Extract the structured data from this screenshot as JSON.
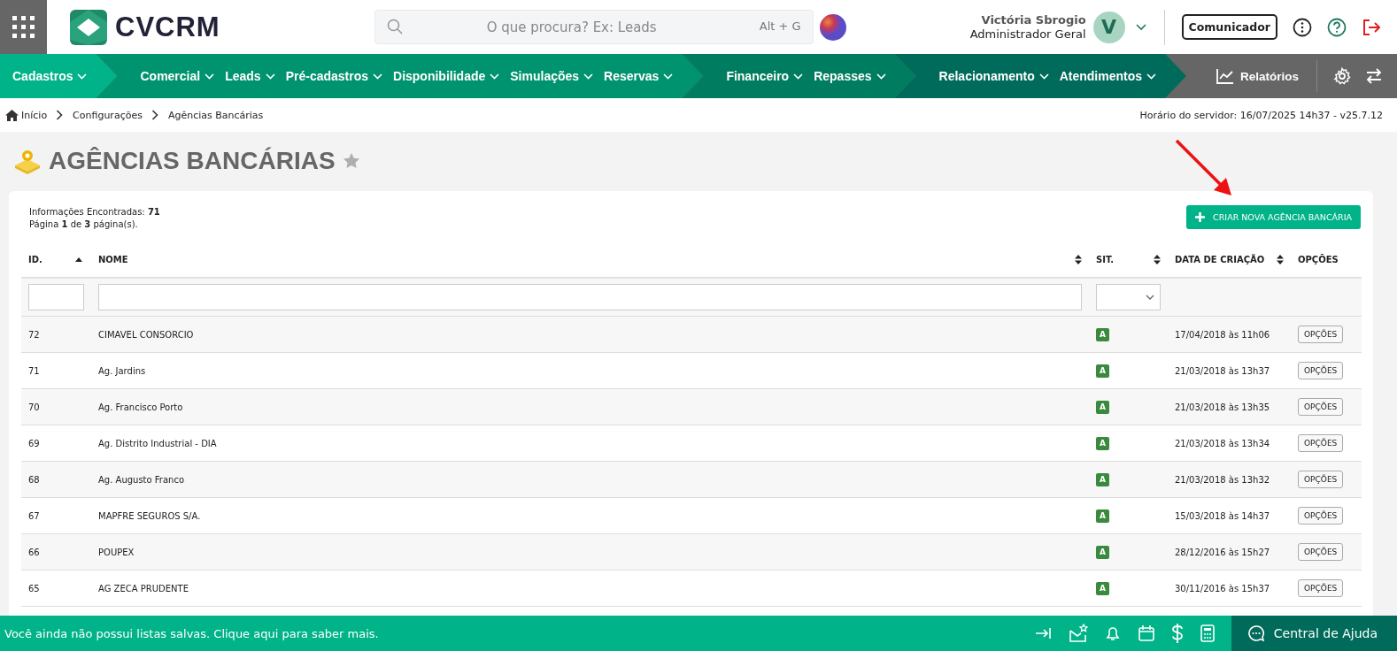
{
  "header": {
    "logo": "CVCRM",
    "search": {
      "placeholder": "O que procura? Ex: Leads",
      "shortcut": "Alt + G"
    },
    "user": {
      "name": "Victória Sbrogio",
      "role": "Administrador Geral",
      "initial": "V"
    },
    "communicator": "Comunicador"
  },
  "nav": {
    "groups": [
      {
        "color": "#00b388",
        "items": [
          "Cadastros"
        ]
      },
      {
        "color": "#00936f",
        "items": [
          "Comercial",
          "Leads",
          "Pré-cadastros",
          "Disponibilidade",
          "Simulações",
          "Reservas"
        ]
      },
      {
        "color": "#007d60",
        "items": [
          "Financeiro",
          "Repasses"
        ]
      },
      {
        "color": "#006b5a",
        "items": [
          "Relacionamento",
          "Atendimentos"
        ]
      }
    ],
    "reports": "Relatórios"
  },
  "breadcrumb": [
    "Início",
    "Configurações",
    "Agências Bancárias"
  ],
  "server_time": "Horário do servidor: 16/07/2025 14h37 - v25.7.12",
  "page_title": "AGÊNCIAS BANCÁRIAS",
  "summary": [
    "Informações Encontradas: **71**",
    "Página **1** de **3** página(s)."
  ],
  "create_button": "CRIAR NOVA AGÊNCIA BANCÁRIA",
  "table": {
    "columns": [
      {
        "label": "ID.",
        "sortable": true,
        "sorted": true
      },
      {
        "label": "NOME",
        "sortable": true,
        "sorted": false
      },
      {
        "label": "SIT.",
        "sortable": true,
        "sorted": false
      },
      {
        "label": "DATA DE CRIAÇÃO",
        "sortable": true,
        "sorted": false
      },
      {
        "label": "OPÇÕES",
        "sortable": false
      }
    ],
    "rows": [
      {
        "id": "72",
        "name": "CIMAVEL CONSORCIO",
        "status": "A",
        "date": "17/04/2018 às 11h06",
        "action": "OPÇÕES"
      },
      {
        "id": "71",
        "name": "Ag. Jardins",
        "status": "A",
        "date": "21/03/2018 às 13h37",
        "action": "OPÇÕES"
      },
      {
        "id": "70",
        "name": "Ag. Francisco Porto",
        "status": "A",
        "date": "21/03/2018 às 13h35",
        "action": "OPÇÕES"
      },
      {
        "id": "69",
        "name": "Ag. Distrito Industrial - DIA",
        "status": "A",
        "date": "21/03/2018 às 13h34",
        "action": "OPÇÕES"
      },
      {
        "id": "68",
        "name": "Ag. Augusto Franco",
        "status": "A",
        "date": "21/03/2018 às 13h32",
        "action": "OPÇÕES"
      },
      {
        "id": "67",
        "name": "MAPFRE SEGUROS S/A.",
        "status": "A",
        "date": "15/03/2018 às 14h37",
        "action": "OPÇÕES"
      },
      {
        "id": "66",
        "name": "POUPEX",
        "status": "A",
        "date": "28/12/2016 às 15h27",
        "action": "OPÇÕES"
      },
      {
        "id": "65",
        "name": "AG ZECA PRUDENTE",
        "status": "A",
        "date": "30/11/2016 às 15h37",
        "action": "OPÇÕES"
      }
    ]
  },
  "footer": {
    "message": "Você ainda não possui listas salvas. Clique aqui para saber mais.",
    "help": "Central de Ajuda"
  }
}
